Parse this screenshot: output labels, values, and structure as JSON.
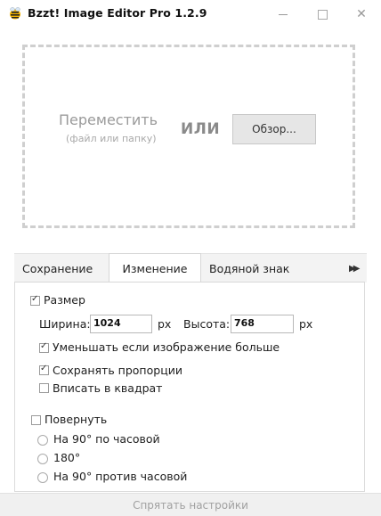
{
  "window": {
    "title": "Bzzt! Image Editor Pro 1.2.9",
    "app_icon": "bee-icon",
    "controls": {
      "minimize": "minimize-icon",
      "maximize": "maximize-icon",
      "close": "✕"
    }
  },
  "dropzone": {
    "move_label": "Переместить",
    "move_sub": "(файл или папку)",
    "or_label": "ИЛИ",
    "browse_button": "Обзор..."
  },
  "tabs": {
    "items": [
      {
        "label": "Сохранение"
      },
      {
        "label": "Изменение",
        "active": true
      },
      {
        "label": "Водяной знак"
      }
    ],
    "more_icon": "▶▶"
  },
  "resize": {
    "enabled_label": "Размер",
    "enabled": true,
    "width_label": "Ширина:",
    "width_value": "1024",
    "width_unit": "px",
    "height_label": "Высота:",
    "height_value": "768",
    "height_unit": "px",
    "options": [
      {
        "label": "Уменьшать если изображение больше",
        "checked": true
      },
      {
        "label": "Сохранять пропорции",
        "checked": true
      },
      {
        "label": "Вписать в квадрат",
        "checked": false
      }
    ]
  },
  "rotate": {
    "enabled_label": "Повернуть",
    "enabled": false,
    "options": [
      {
        "label": "На 90° по часовой"
      },
      {
        "label": "180°"
      },
      {
        "label": "На 90° против часовой"
      }
    ]
  },
  "footer": {
    "hide_settings": "Спрятать настройки"
  }
}
